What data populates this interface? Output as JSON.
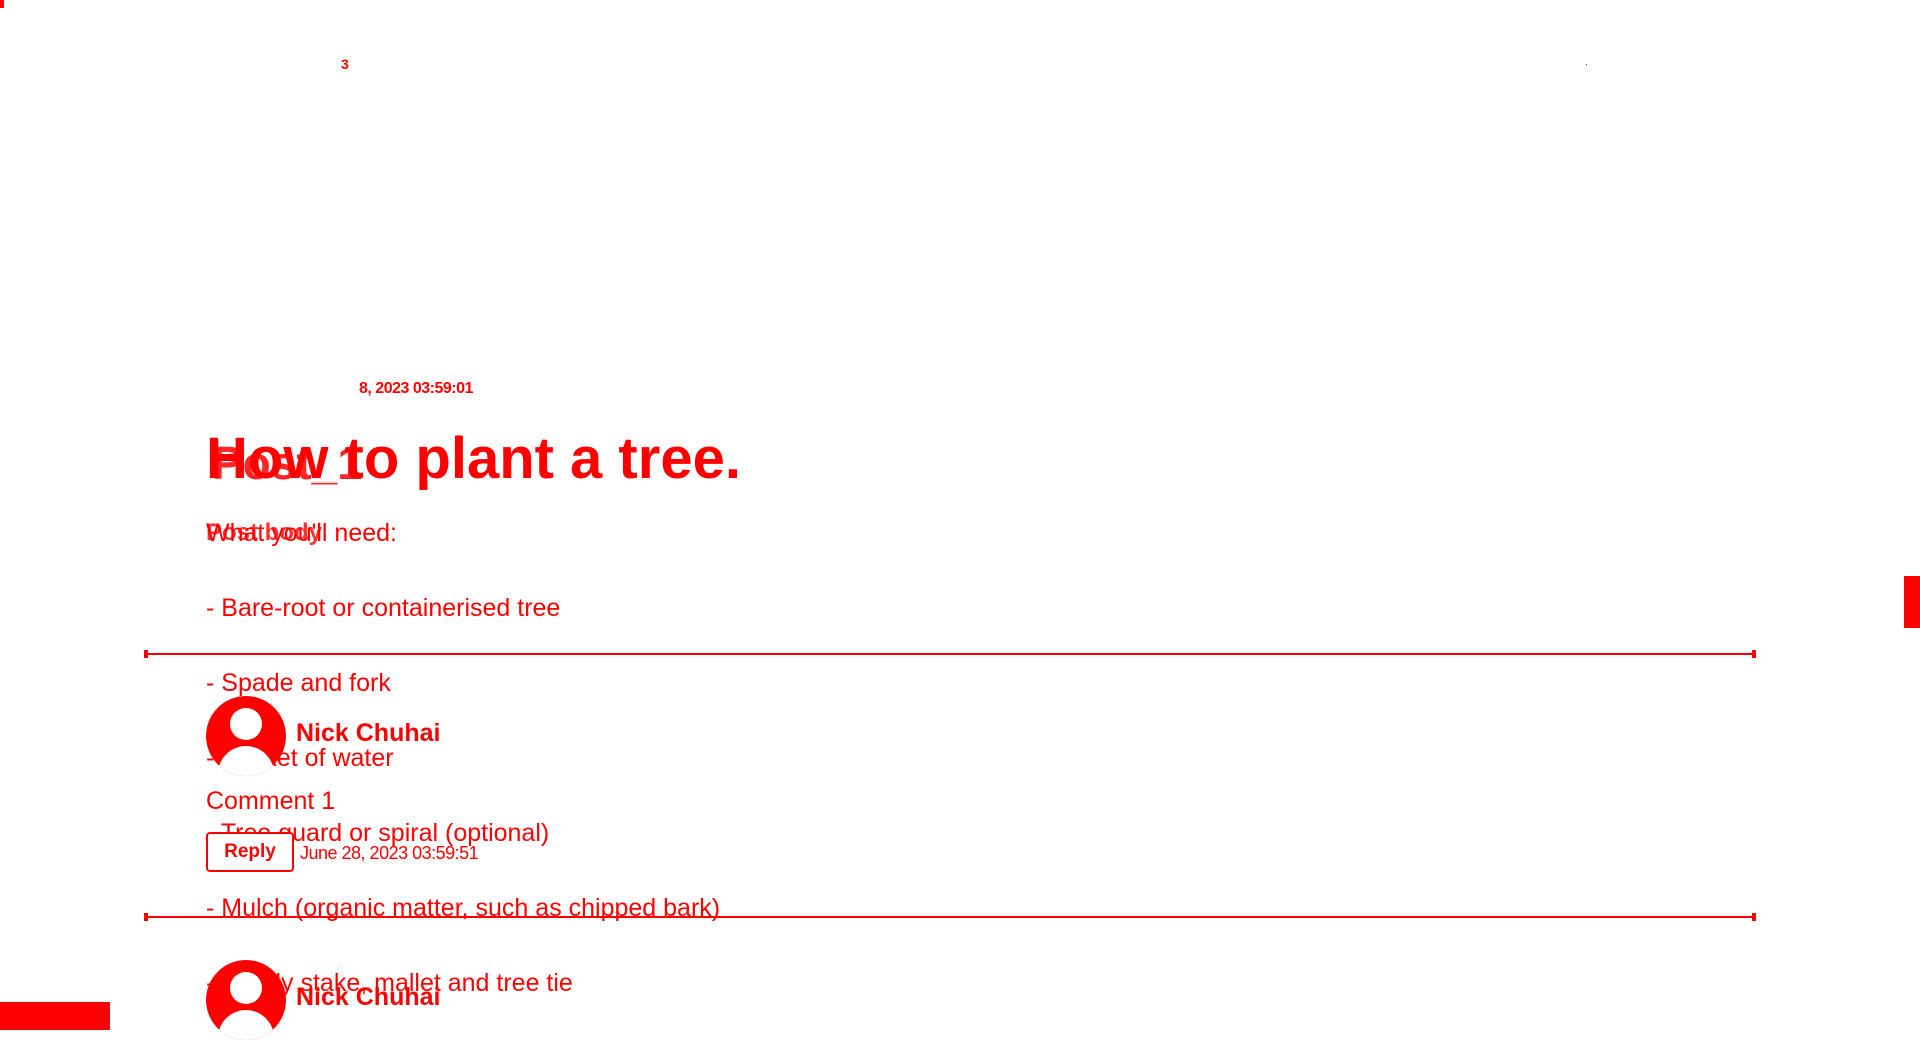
{
  "header": {
    "badge": "3"
  },
  "post": {
    "meta_date": "8, 2023 03:59:01",
    "title": "How to plant a tree.",
    "title_overlay": "Post_1",
    "body_overlay": "Post body",
    "lines": [
      "What you'll need:",
      "- Bare-root or containerised tree",
      "- Spade and fork",
      "- Bucket of water",
      "- Tree guard or spiral (optional)",
      "- Mulch (organic matter, such as chipped bark)",
      "- Sturdy stake, mallet and tree tie"
    ]
  },
  "comments": [
    {
      "author": "Nick Chuhai",
      "text": "Comment 1",
      "reply_label": "Reply",
      "date": "June 28, 2023 03:59:51"
    },
    {
      "author": "Nick Chuhai"
    }
  ],
  "colors": {
    "accent": "#ff0000",
    "background": "#ffffff"
  }
}
